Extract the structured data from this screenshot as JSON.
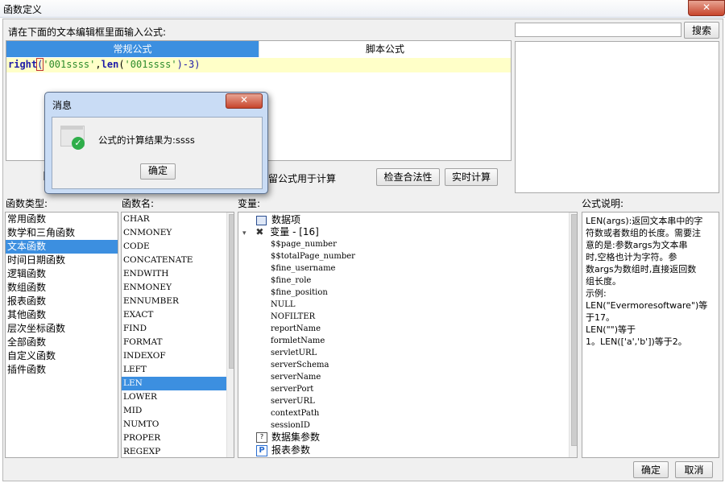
{
  "window": {
    "title": "函数定义",
    "close_glyph": "✕"
  },
  "prompt_label": "请在下面的文本编辑框里面输入公式:",
  "search": {
    "value": "",
    "button": "搜索"
  },
  "tabs": [
    {
      "label": "常规公式",
      "active": true
    },
    {
      "label": "脚本公式",
      "active": false
    }
  ],
  "editor": {
    "fn1": "right",
    "paren_open": "(",
    "str1": "'001ssss'",
    "comma": ",",
    "fn2": "len",
    "str2": "'001ssss'",
    "tail": ")-3)"
  },
  "checkbox_label": "留公式用于计算",
  "buttons": {
    "check": "检查合法性",
    "realtime": "实时计算",
    "ok": "确定",
    "cancel": "取消"
  },
  "columns": {
    "func_type": "函数类型:",
    "func_name": "函数名:",
    "variables": "变量:",
    "description": "公式说明:"
  },
  "func_types": [
    "常用函数",
    "数学和三角函数",
    "文本函数",
    "时间日期函数",
    "逻辑函数",
    "数组函数",
    "报表函数",
    "其他函数",
    "层次坐标函数",
    "全部函数",
    "自定义函数",
    "插件函数"
  ],
  "func_type_selected": 2,
  "func_names": [
    "CHAR",
    "CNMONEY",
    "CODE",
    "CONCATENATE",
    "ENDWITH",
    "ENMONEY",
    "ENNUMBER",
    "EXACT",
    "FIND",
    "FORMAT",
    "INDEXOF",
    "LEFT",
    "LEN",
    "LOWER",
    "MID",
    "NUMTO",
    "PROPER",
    "REGEXP"
  ],
  "func_name_selected": 12,
  "tree": {
    "data_item": "数据项",
    "variables_group": "变量 - [16]",
    "vars": [
      "$$page_number",
      "$$totalPage_number",
      "$fine_username",
      "$fine_role",
      "$fine_position",
      "NULL",
      "NOFILTER",
      "reportName",
      "formletName",
      "servletURL",
      "serverSchema",
      "serverName",
      "serverPort",
      "serverURL",
      "contextPath",
      "sessionID"
    ],
    "dataset_params": "数据集参数",
    "report_params": "报表参数",
    "report_icon_letter": "P"
  },
  "description": {
    "lines": [
      "LEN(args):返回文本串中的字",
      "符数或者数组的长度。需要注",
      "意的是:参数args为文本串",
      "时,空格也计为字符。参",
      "数args为数组时,直接返回数",
      "组长度。",
      "示例:",
      "LEN(\"Evermoresoftware\")等",
      "于17。",
      "LEN(\"\")等于",
      "1。LEN(['a','b'])等于2。"
    ]
  },
  "dialog": {
    "title": "消息",
    "message": "公式的计算结果为:ssss",
    "ok": "确定",
    "close_glyph": "✕"
  },
  "colors": {
    "accent": "#3c8fe0",
    "editor_bg": "#ffffc8",
    "keyword": "#1d1aa8",
    "string": "#2b8a2b"
  }
}
